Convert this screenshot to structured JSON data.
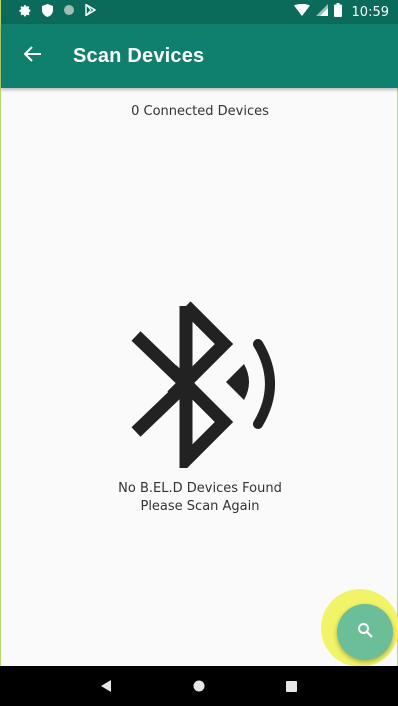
{
  "status_bar": {
    "time": "10:59",
    "left_icons": [
      "settings-icon",
      "shield-icon",
      "circle-icon",
      "play-store-icon"
    ],
    "right_icons": [
      "wifi-icon",
      "signal-icon",
      "battery-icon"
    ]
  },
  "app_bar": {
    "back_icon": "arrow-left-icon",
    "title": "Scan Devices",
    "color": "#10806e"
  },
  "main": {
    "connected_count": "0 Connected Devices",
    "empty_line1": "No B.EL.D Devices Found",
    "empty_line2": "Please Scan Again",
    "graphic_icon": "bluetooth-searching-icon"
  },
  "fab": {
    "icon": "search-icon",
    "color": "#6abe98",
    "highlight": "#f1f466"
  },
  "nav_bar": {
    "buttons": [
      "back-triangle-icon",
      "home-circle-icon",
      "recents-square-icon"
    ]
  }
}
